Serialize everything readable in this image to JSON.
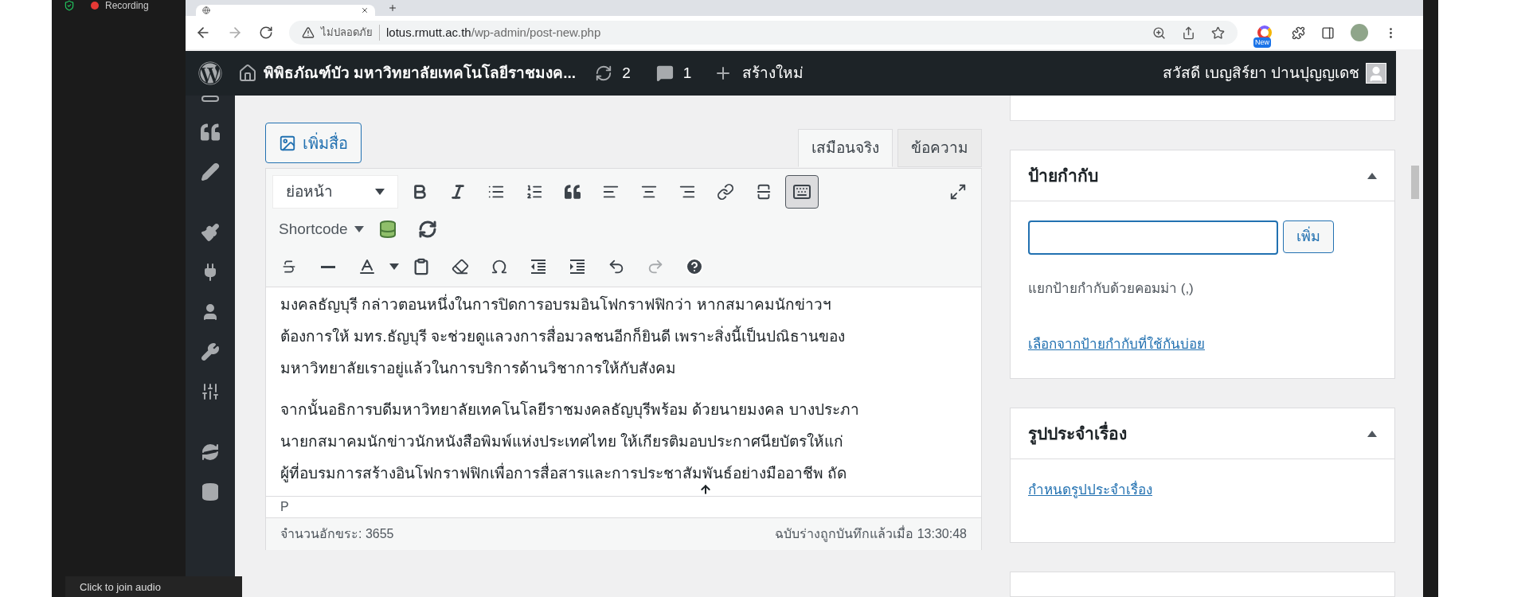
{
  "recorder": {
    "label": "Recording"
  },
  "browser": {
    "security_label": "ไม่ปลอดภัย",
    "url_host": "lotus.rmutt.ac.th",
    "url_path": "/wp-admin/post-new.php",
    "extension_badge": "New"
  },
  "admin_bar": {
    "site_name": "พิพิธภัณฑ์บัว มหาวิทยาลัยเทคโนโลยีราชมงค...",
    "updates": "2",
    "comments": "1",
    "new_label": "สร้างใหม่",
    "greeting": "สวัสดี เบญสิร์ยา ปานปุญญเดช"
  },
  "editor": {
    "add_media": "เพิ่มสื่อ",
    "tabs": [
      {
        "label": "เสมือนจริง",
        "selected": true
      },
      {
        "label": "ข้อความ",
        "selected": false
      }
    ],
    "format_select": "ย่อหน้า",
    "shortcode_label": "Shortcode",
    "kitchen_sink_pressed": true,
    "paragraphs": [
      [
        "มงคลธัญบุรี กล่าวตอนหนึ่งในการปิดการอบรมอินโฟกราฟฟิกว่า หากสมาคมนักข่าวฯ",
        "ต้องการให้ มทร.ธัญบุรี จะช่วยดูแลวงการสื่อมวลชนอีกก็ยินดี เพราะสิ่งนี้เป็นปณิธานของ",
        "มหาวิทยาลัยเราอยู่แล้วในการบริการด้านวิชาการให้กับสังคม"
      ],
      [
        "จากนั้นอธิการบดีมหาวิทยาลัยเทคโนโลยีราชมงคลธัญบุรีพร้อม ด้วยนายมงคล บางประภา",
        "นายกสมาคมนักข่าวนักหนังสือพิมพ์แห่งประเทศไทย ให้เกียรติมอบประกาศนียบัตรให้แก่",
        "ผู้ที่อบรมการสร้างอินโฟกราฟฟิกเพื่อการสื่อสารและการประชาสัมพันธ์อย่างมืออาชีพ ถัด"
      ]
    ],
    "path": "P",
    "word_count": "จำนวนอักขระ: 3655",
    "draft_saved": "ฉบับร่างถูกบันทึกแล้วเมื่อ 13:30:48"
  },
  "sidebar": {
    "boxes": [
      {
        "kind": "tags",
        "title": "ป้ายกำกับ",
        "expanded": true,
        "button": "เพิ่ม",
        "hint": "แยกป้ายกำกับด้วยคอมม่า (,)",
        "link": "เลือกจากป้ายกำกับที่ใช้กันบ่อย"
      },
      {
        "kind": "featured",
        "title": "รูปประจำเรื่อง",
        "expanded": true,
        "link": "กำหนดรูปประจำเรื่อง"
      }
    ]
  },
  "audio_popup": {
    "label": "Click to join audio"
  }
}
